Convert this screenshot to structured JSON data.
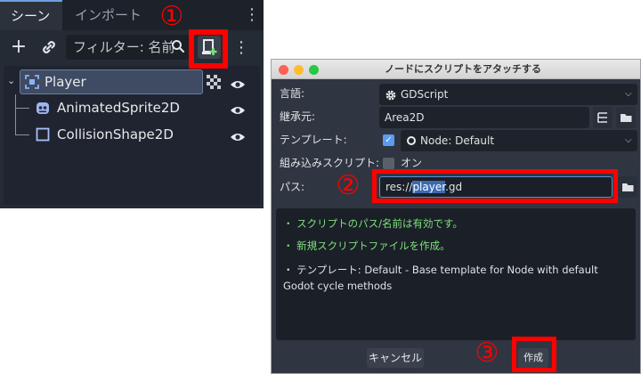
{
  "scene_dock": {
    "tabs": [
      {
        "label": "シーン"
      },
      {
        "label": "インポート"
      }
    ],
    "filter_placeholder": "フィルター: 名前",
    "icons": {
      "add": "plus-icon",
      "link": "link-icon",
      "search": "search-icon",
      "attach": "attach-script-icon",
      "more": "more-icon"
    },
    "tree": [
      {
        "label": "Player",
        "icon": "area2d-icon",
        "selected": true
      },
      {
        "label": "AnimatedSprite2D",
        "icon": "animated-sprite-icon"
      },
      {
        "label": "CollisionShape2D",
        "icon": "collision-shape-icon"
      }
    ]
  },
  "dialog": {
    "title": "ノードにスクリプトをアタッチする",
    "language": {
      "label": "言語:",
      "value": "GDScript"
    },
    "inherits": {
      "label": "継承元:",
      "value": "Area2D"
    },
    "template": {
      "label": "テンプレート:",
      "value": "Node: Default",
      "checked": true
    },
    "builtin": {
      "label": "組み込みスクリプト:",
      "value": "オン",
      "checked": false
    },
    "path": {
      "label": "パス:",
      "prefix": "res://",
      "selected": "player",
      "suffix": ".gd"
    },
    "messages": [
      {
        "text": "・ スクリプトのパス/名前は有効です。",
        "status": "ok"
      },
      {
        "text": "・ 新規スクリプトファイルを作成。",
        "status": "ok"
      },
      {
        "text": "・ テンプレート: Default - Base template for Node with default Godot cycle methods",
        "status": "info"
      }
    ],
    "cancel_label": "キャンセル",
    "create_label": "作成"
  },
  "annotations": {
    "step1": "①",
    "step2": "②",
    "step3": "③"
  },
  "colors": {
    "highlight": "#ff0000",
    "ok": "#7de07d",
    "accent": "#5c8fd6"
  }
}
